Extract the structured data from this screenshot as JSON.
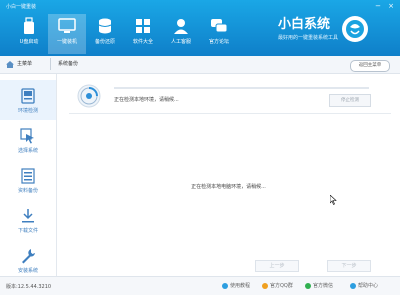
{
  "window": {
    "title": "小白一键重装",
    "controls": [
      "−",
      "×"
    ]
  },
  "nav": {
    "items": [
      {
        "label": "U盘启动",
        "icon": "usb-drive-icon",
        "active": false
      },
      {
        "label": "一键装机",
        "icon": "monitor-icon",
        "active": true
      },
      {
        "label": "备份还原",
        "icon": "database-icon",
        "active": false
      },
      {
        "label": "软件大全",
        "icon": "apps-grid-icon",
        "active": false
      },
      {
        "label": "人工客服",
        "icon": "headset-icon",
        "active": false
      },
      {
        "label": "官方论坛",
        "icon": "forum-icon",
        "active": false
      }
    ]
  },
  "brand": {
    "title": "小白系统",
    "subtitle": "最好用的一键重装系统工具"
  },
  "breadcrumb": {
    "home": "主菜单",
    "current": "系统备份",
    "return_label": "返回主菜单"
  },
  "sidebar": {
    "items": [
      {
        "label": "环境检测",
        "icon": "computer-check-icon",
        "active": true
      },
      {
        "label": "选择系统",
        "icon": "cursor-select-icon",
        "active": false
      },
      {
        "label": "资料备份",
        "icon": "backup-list-icon",
        "active": false
      },
      {
        "label": "下载文件",
        "icon": "download-icon",
        "active": false
      },
      {
        "label": "安装系统",
        "icon": "wrench-icon",
        "active": false
      }
    ]
  },
  "main": {
    "status_top": "正在检测本地环境，请稍候...",
    "stop_label": "停止检测",
    "status_center": "正在检测本地电脑环境，请稍候...",
    "prev_label": "上一步",
    "next_label": "下一步"
  },
  "statusbar": {
    "version": "版本:12.5.44.3210",
    "items": [
      {
        "label": "使用教程",
        "color": "#2d9ee0"
      },
      {
        "label": "官方QQ群",
        "color": "#f0a020"
      },
      {
        "label": "官方微信",
        "color": "#30b050"
      },
      {
        "label": "帮助中心",
        "color": "#2d9ee0"
      }
    ]
  },
  "colors": {
    "accent": "#0f7fc9",
    "sidebar_active": "#eaf3fd"
  }
}
